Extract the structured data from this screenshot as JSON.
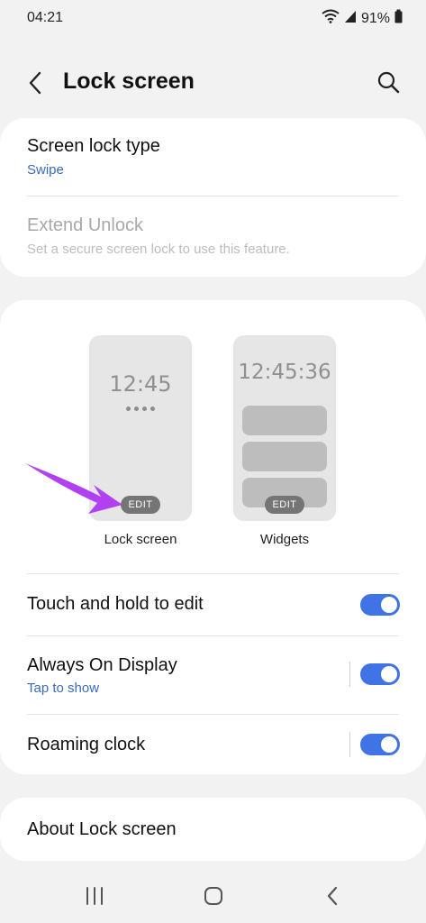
{
  "status": {
    "time": "04:21",
    "battery": "91%"
  },
  "header": {
    "title": "Lock screen"
  },
  "lock_settings": {
    "screen_lock_type": {
      "title": "Screen lock type",
      "value": "Swipe"
    },
    "extend_unlock": {
      "title": "Extend Unlock",
      "subtitle": "Set a secure screen lock to use this feature."
    }
  },
  "previews": {
    "lock_screen": {
      "clock": "12:45",
      "edit": "EDIT",
      "label": "Lock screen"
    },
    "widgets": {
      "clock": "12:45:36",
      "edit": "EDIT",
      "label": "Widgets"
    }
  },
  "toggles": {
    "touch_hold": {
      "title": "Touch and hold to edit",
      "enabled": true
    },
    "always_on": {
      "title": "Always On Display",
      "subtitle": "Tap to show",
      "enabled": true
    },
    "roaming_clock": {
      "title": "Roaming clock",
      "enabled": true
    }
  },
  "about": {
    "title": "About Lock screen"
  },
  "colors": {
    "accent": "#3f73e6",
    "link": "#3a6bbf",
    "arrow": "#b141f0"
  }
}
